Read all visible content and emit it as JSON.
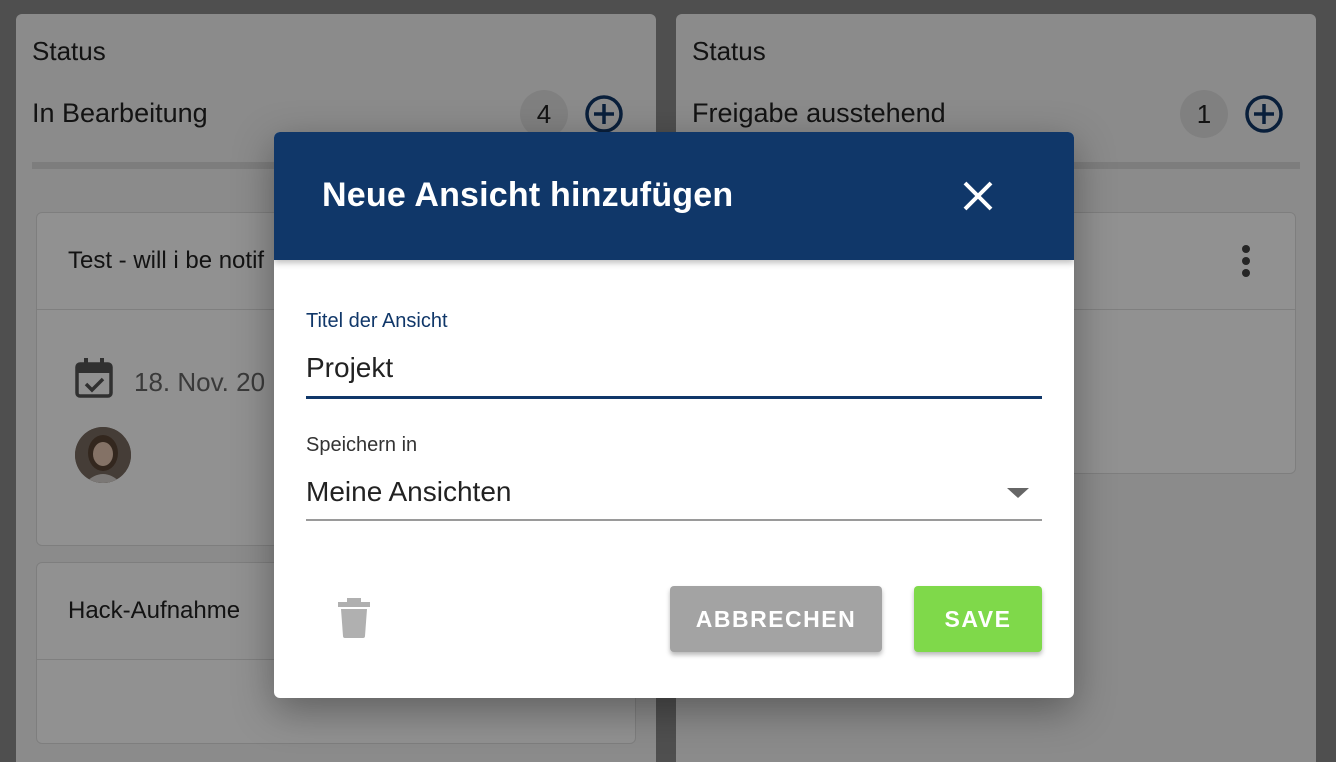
{
  "board": {
    "columns": [
      {
        "status_label": "Status",
        "name": "In Bearbeitung",
        "count": "4",
        "cards": [
          {
            "title": "Test - will i be notif",
            "date": "18. Nov. 20"
          },
          {
            "title": "Hack-Aufnahme"
          }
        ]
      },
      {
        "status_label": "Status",
        "name": "Freigabe ausstehend",
        "count": "1"
      }
    ]
  },
  "dialog": {
    "title": "Neue Ansicht hinzufügen",
    "title_field": {
      "label": "Titel der Ansicht",
      "value": "Projekt"
    },
    "save_in_field": {
      "label": "Speichern in",
      "value": "Meine Ansichten"
    },
    "cancel_label": "ABBRECHEN",
    "save_label": "SAVE"
  },
  "colors": {
    "header": "#103769",
    "save_button": "#7fd94a",
    "cancel_button": "#a3a3a3",
    "overlay": "rgba(0,0,0,0.43)"
  },
  "icons": {
    "close": "close-icon",
    "trash": "trash-icon",
    "add": "add-circle-icon",
    "calendar": "calendar-check-icon",
    "kebab": "more-vert-icon"
  }
}
